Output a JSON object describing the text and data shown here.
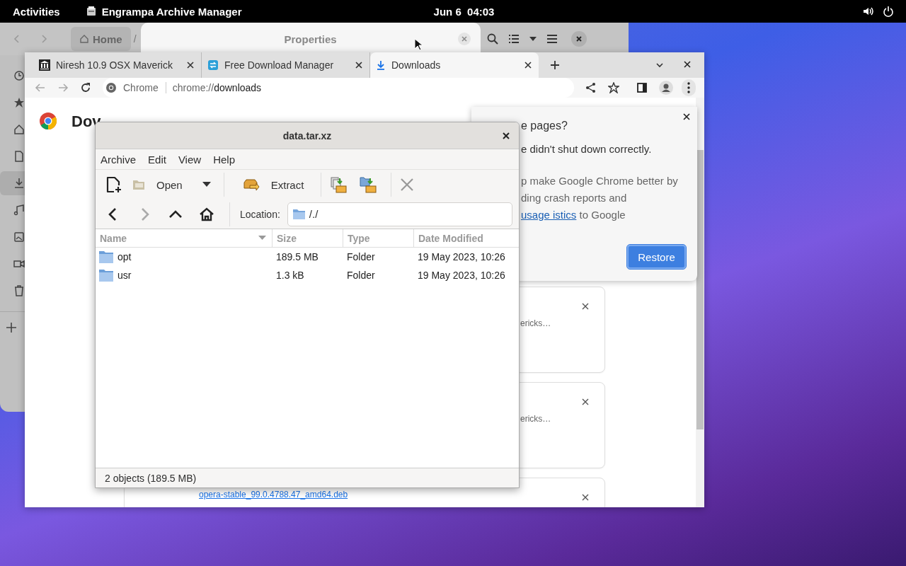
{
  "top_bar": {
    "activities": "Activities",
    "app_name": "Engrampa Archive Manager",
    "clock": "Jun 6  04:03"
  },
  "files_window": {
    "path_button": "Home",
    "path_separator": "/",
    "dialog_title": "Properties",
    "sidebar": [
      {
        "kind": "recent",
        "selected": false
      },
      {
        "kind": "starred",
        "selected": false
      },
      {
        "kind": "home",
        "selected": false
      },
      {
        "kind": "documents",
        "selected": false
      },
      {
        "kind": "downloads",
        "selected": true
      },
      {
        "kind": "music",
        "selected": false
      },
      {
        "kind": "pictures",
        "selected": false
      },
      {
        "kind": "videos",
        "selected": false
      },
      {
        "kind": "trash",
        "selected": false
      }
    ]
  },
  "browser": {
    "tabs": [
      {
        "label": "Niresh 10.9 OSX Maverick",
        "selected": false,
        "kind": "site"
      },
      {
        "label": "Free Download Manager",
        "selected": false,
        "kind": "fdm"
      },
      {
        "label": "Downloads",
        "selected": true,
        "kind": "downloads"
      }
    ],
    "omnibox": {
      "site": "Chrome",
      "scheme": "chrome://",
      "path": "downloads"
    },
    "page_heading": "Dov",
    "download_cards": [
      {
        "text": "ericks…"
      },
      {
        "text": "ericks…"
      },
      {
        "link": "opera-stable_99.0.4788.47_amd64.deb"
      }
    ]
  },
  "restore_popup": {
    "title": "e pages?",
    "message": "e didn't shut down correctly.",
    "consent_before": "p make Google Chrome better by ding crash reports and",
    "consent_link": "usage istics",
    "consent_after": "to Google",
    "button": "Restore"
  },
  "archive_window": {
    "title": "data.tar.xz",
    "menu": [
      "Archive",
      "Edit",
      "View",
      "Help"
    ],
    "open_button": "Open",
    "extract_button": "Extract",
    "nav": [
      {
        "kind": "back",
        "disabled": false
      },
      {
        "kind": "forward",
        "disabled": true
      },
      {
        "kind": "up",
        "disabled": false
      },
      {
        "kind": "home",
        "disabled": false
      }
    ],
    "location_label": "Location:",
    "location": "/./",
    "columns": [
      "Name",
      "Size",
      "Type",
      "Date Modified"
    ],
    "rows": [
      {
        "name": "opt",
        "size": "189.5 MB",
        "type": "Folder",
        "date": "19 May 2023, 10:26"
      },
      {
        "name": "usr",
        "size": "1.3 kB",
        "type": "Folder",
        "date": "19 May 2023, 10:26"
      }
    ],
    "status": "2 objects (189.5 MB)"
  }
}
